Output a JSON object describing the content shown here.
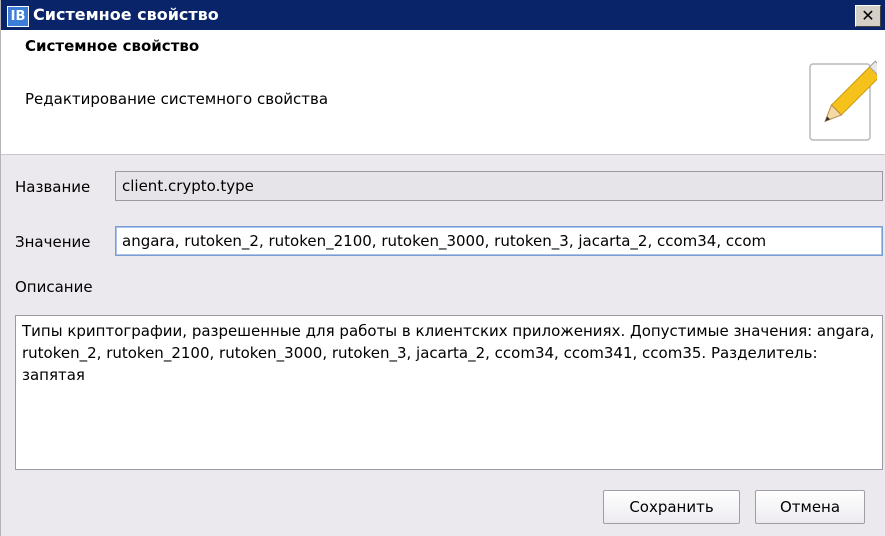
{
  "window": {
    "title": "Системное свойство",
    "logo_text": "IB",
    "close_glyph": "✕"
  },
  "header": {
    "title": "Системное свойство",
    "subtitle": "Редактирование системного свойства",
    "icon": "pencil-icon"
  },
  "form": {
    "name_label": "Название",
    "name_value": "client.crypto.type",
    "value_label": "Значение",
    "value_value": "angara, rutoken_2, rutoken_2100, rutoken_3000, rutoken_3, jacarta_2, ccom34, ccom",
    "description_label": "Описание",
    "description_value": "Типы криптографии, разрешенные для работы в клиентских приложениях. Допустимые значения: angara, rutoken_2, rutoken_2100, rutoken_3000, rutoken_3, jacarta_2, ccom34, ccom341, ccom35. Разделитель: запятая"
  },
  "buttons": {
    "save": "Сохранить",
    "cancel": "Отмена"
  },
  "colors": {
    "titlebar": "#0a246a",
    "dialog_bg": "#ebe9ed",
    "focus_border": "#7a9cd3"
  }
}
